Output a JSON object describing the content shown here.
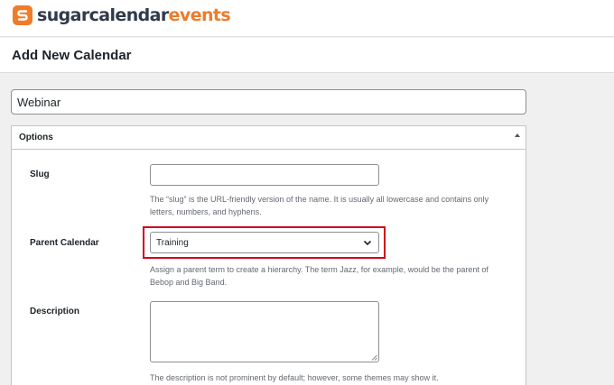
{
  "brand": {
    "name_part1": "sugarcalendar",
    "name_part2": "events",
    "accent_color": "#f07b29",
    "dark_color": "#2f3a4a"
  },
  "page": {
    "title": "Add New Calendar"
  },
  "name_field": {
    "value": "Webinar"
  },
  "options_panel": {
    "title": "Options",
    "toggle_icon": "triangle-up-icon",
    "slug": {
      "label": "Slug",
      "value": "",
      "help": "The “slug” is the URL-friendly version of the name. It is usually all lowercase and contains only letters, numbers, and hyphens."
    },
    "parent": {
      "label": "Parent Calendar",
      "selected": "Training",
      "help": "Assign a parent term to create a hierarchy. The term Jazz, for example, would be the parent of Bebop and Big Band.",
      "highlight_color": "#d0021b"
    },
    "description": {
      "label": "Description",
      "value": "",
      "help": "The description is not prominent by default; however, some themes may show it."
    }
  }
}
